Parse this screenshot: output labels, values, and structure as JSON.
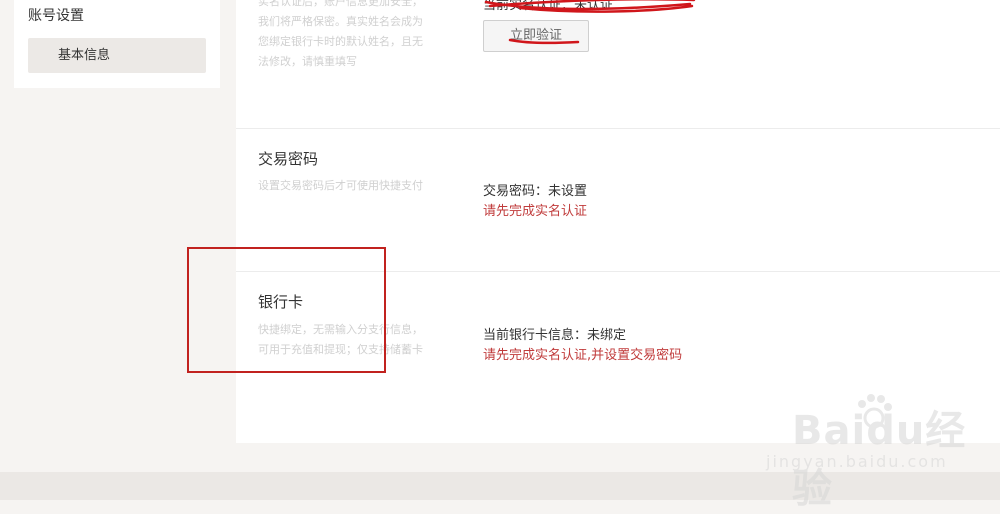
{
  "sidebar": {
    "group_title": "账号设置",
    "items": [
      {
        "label": "基本信息"
      }
    ]
  },
  "realname": {
    "desc_lines": [
      "实名认证后，账户信息更加安全，",
      "我们将严格保密。真实姓名会成为",
      "您绑定银行卡时的默认姓名，且无",
      "法修改，请慎重填写"
    ],
    "status": "当前实名认证：未认证",
    "verify_button": "立即验证"
  },
  "trade_password": {
    "title": "交易密码",
    "desc": "设置交易密码后才可使用快捷支付",
    "status": "交易密码：未设置",
    "hint": "请先完成实名认证"
  },
  "bank_card": {
    "title": "银行卡",
    "desc_lines": [
      "快捷绑定，无需输入分支行信息，",
      "可用于充值和提现；仅支持储蓄卡"
    ],
    "status": "当前银行卡信息：未绑定",
    "hint": "请先完成实名认证,并设置交易密码"
  },
  "watermark": {
    "brand": "Baidu经验",
    "url": "jingyan.baidu.com"
  },
  "colors": {
    "hint_red": "#c03b3b",
    "annotation_red": "#c1221f"
  }
}
